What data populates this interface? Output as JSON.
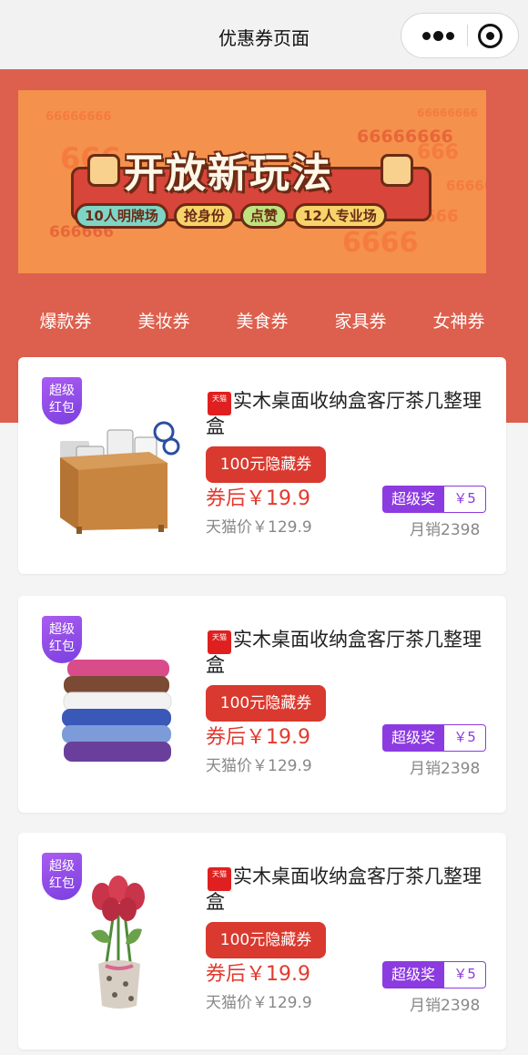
{
  "navbar": {
    "title": "优惠券页面",
    "more_icon": "more-dots-icon",
    "close_icon": "target-circle-icon"
  },
  "banner": {
    "title": "开放新玩法",
    "tags": [
      "10人明牌场",
      "抢身份",
      "点赞",
      "12人专业场"
    ],
    "background_numbers": [
      "666",
      "66666666",
      "666",
      "66666",
      "666666",
      "6666",
      "66666666",
      "66666666",
      "666"
    ]
  },
  "tabs": [
    "爆款券",
    "美妆券",
    "美食券",
    "家具券",
    "女神券"
  ],
  "products": [
    {
      "badge": "超级红包",
      "image": "desk-organizer-box",
      "store_icon_text": "天猫",
      "title": "实木桌面收纳盒客厅茶几整理盒",
      "coupon": "100元隐藏券",
      "after_price": "券后￥19.9",
      "tmall_price": "天猫价￥129.9",
      "reward_label": "超级奖",
      "reward_value": "￥5",
      "sales": "月销2398"
    },
    {
      "badge": "超级红包",
      "image": "stacked-towels",
      "store_icon_text": "天猫",
      "title": "实木桌面收纳盒客厅茶几整理盒",
      "coupon": "100元隐藏券",
      "after_price": "券后￥19.9",
      "tmall_price": "天猫价￥129.9",
      "reward_label": "超级奖",
      "reward_value": "￥5",
      "sales": "月销2398"
    },
    {
      "badge": "超级红包",
      "image": "tulip-bouquet-vase",
      "store_icon_text": "天猫",
      "title": "实木桌面收纳盒客厅茶几整理盒",
      "coupon": "100元隐藏券",
      "after_price": "券后￥19.9",
      "tmall_price": "天猫价￥129.9",
      "reward_label": "超级奖",
      "reward_value": "￥5",
      "sales": "月销2398"
    }
  ],
  "colors": {
    "header_red": "#dd5f4d",
    "coupon_red": "#d9392e",
    "price_red": "#e23a2e",
    "reward_purple": "#8c3be0",
    "banner_orange": "#f4914c"
  }
}
